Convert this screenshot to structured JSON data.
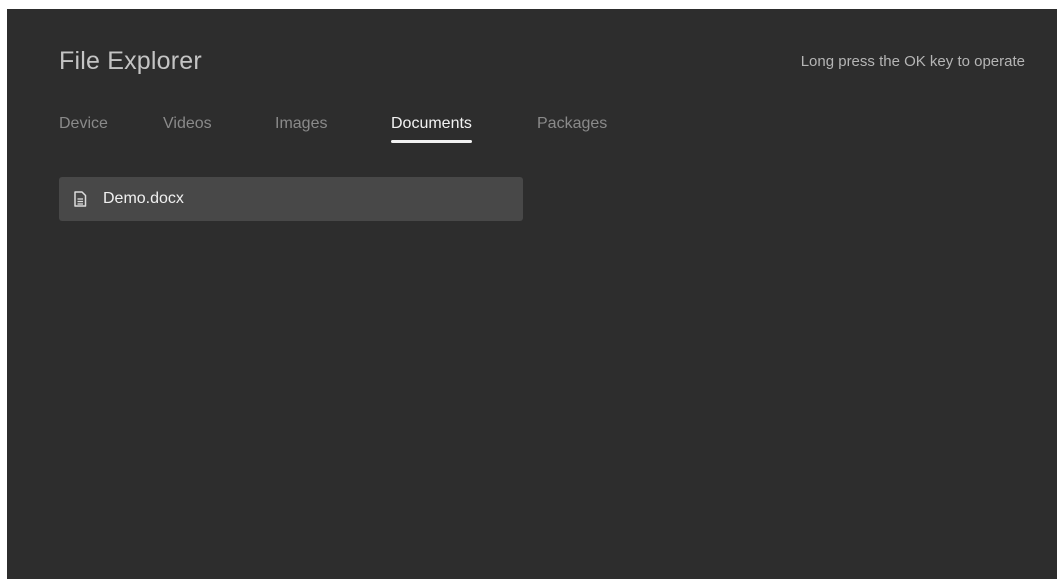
{
  "app": {
    "title": "File Explorer",
    "hint": "Long press the OK key to operate"
  },
  "tabs": [
    {
      "label": "Device",
      "active": false
    },
    {
      "label": "Videos",
      "active": false
    },
    {
      "label": "Images",
      "active": false
    },
    {
      "label": "Documents",
      "active": true
    },
    {
      "label": "Packages",
      "active": false
    }
  ],
  "files": [
    {
      "name": "Demo.docx",
      "icon": "document-icon",
      "focused": true
    }
  ],
  "colors": {
    "background": "#2d2d2d",
    "focused_row": "#484848",
    "active_tab": "#f2f2f2",
    "inactive_tab": "#8a8a8a"
  }
}
